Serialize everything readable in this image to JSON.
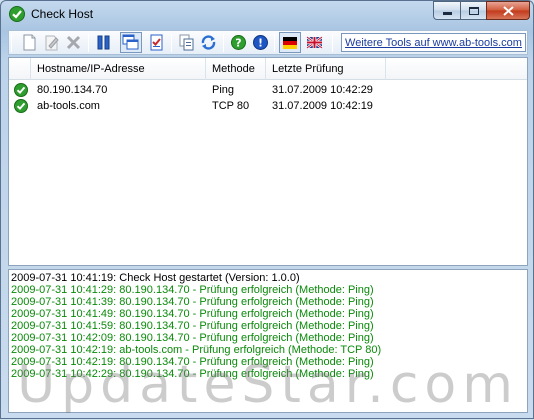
{
  "window": {
    "title": "Check Host"
  },
  "toolbar": {
    "buttons": [
      "new-icon",
      "edit-icon",
      "delete-icon",
      "pause-icon",
      "windows-icon",
      "checklist-icon",
      "copy-icon",
      "refresh-icon",
      "help-icon",
      "info-icon",
      "flag-germany-icon",
      "flag-uk-icon"
    ],
    "link_label": "Weitere Tools auf www.ab-tools.com"
  },
  "list": {
    "columns": [
      "Hostname/IP-Adresse",
      "Methode",
      "Letzte Prüfung"
    ],
    "rows": [
      {
        "host": "80.190.134.70",
        "method": "Ping",
        "last_check": "31.07.2009 10:42:29",
        "status": "ok"
      },
      {
        "host": "ab-tools.com",
        "method": "TCP 80",
        "last_check": "31.07.2009 10:42:19",
        "status": "ok"
      }
    ]
  },
  "log": {
    "lines": [
      {
        "text": "2009-07-31 10:41:19: Check Host gestartet (Version: 1.0.0)",
        "color": "#000000"
      },
      {
        "text": "2009-07-31 10:41:29: 80.190.134.70 - Prüfung erfolgreich (Methode: Ping)",
        "color": "#0a8a0a"
      },
      {
        "text": "2009-07-31 10:41:39: 80.190.134.70 - Prüfung erfolgreich (Methode: Ping)",
        "color": "#0a8a0a"
      },
      {
        "text": "2009-07-31 10:41:49: 80.190.134.70 - Prüfung erfolgreich (Methode: Ping)",
        "color": "#0a8a0a"
      },
      {
        "text": "2009-07-31 10:41:59: 80.190.134.70 - Prüfung erfolgreich (Methode: Ping)",
        "color": "#0a8a0a"
      },
      {
        "text": "2009-07-31 10:42:09: 80.190.134.70 - Prüfung erfolgreich (Methode: Ping)",
        "color": "#0a8a0a"
      },
      {
        "text": "2009-07-31 10:42:19: ab-tools.com - Prüfung erfolgreich (Methode: TCP 80)",
        "color": "#0a8a0a"
      },
      {
        "text": "2009-07-31 10:42:19: 80.190.134.70 - Prüfung erfolgreich (Methode: Ping)",
        "color": "#0a8a0a"
      },
      {
        "text": "2009-07-31 10:42:29: 80.190.134.70 - Prüfung erfolgreich (Methode: Ping)",
        "color": "#0a8a0a"
      }
    ]
  },
  "watermark": "UpdateStar.com"
}
